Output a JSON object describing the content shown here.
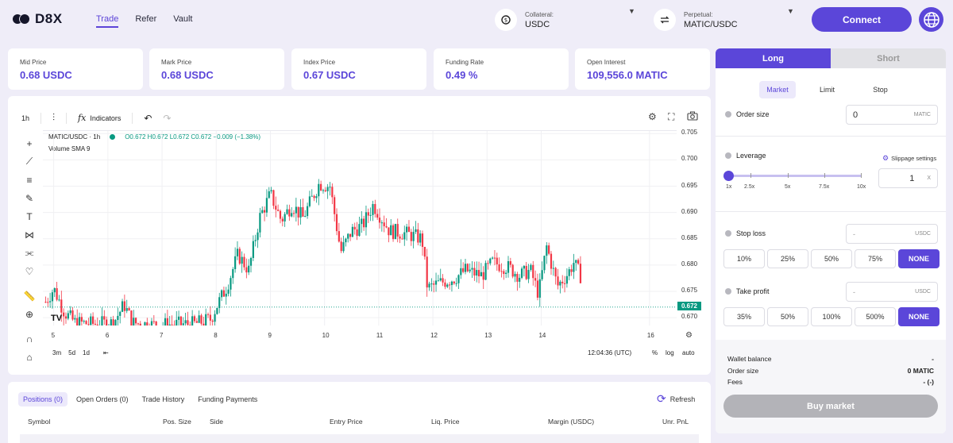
{
  "app": {
    "name": "D8X"
  },
  "nav": [
    {
      "label": "Trade",
      "active": true
    },
    {
      "label": "Refer",
      "active": false
    },
    {
      "label": "Vault",
      "active": false
    }
  ],
  "collateral": {
    "label": "Collateral:",
    "value": "USDC",
    "icon": "coins-icon"
  },
  "perpetual": {
    "label": "Perpetual:",
    "value": "MATIC/USDC",
    "icon": "swap-icon"
  },
  "connect_label": "Connect",
  "stats": [
    {
      "label": "Mid Price",
      "value": "0.68 USDC"
    },
    {
      "label": "Mark Price",
      "value": "0.68 USDC"
    },
    {
      "label": "Index Price",
      "value": "0.67 USDC"
    },
    {
      "label": "Funding Rate",
      "value": "0.49 %"
    },
    {
      "label": "Open Interest",
      "value": "109,556.0 MATIC"
    }
  ],
  "chart": {
    "interval": "1h",
    "indicators_label": "Indicators",
    "symbol": "MATIC/USDC · 1h",
    "ohlc": "O0.672 H0.672 L0.672 C0.672 −0.009 (−1.38%)",
    "volume_label": "Volume SMA 9",
    "price_tag": "0.672",
    "ranges": [
      "3m",
      "5d",
      "1d"
    ],
    "time": "12:04:36 (UTC)",
    "pct": "%",
    "log": "log",
    "auto": "auto"
  },
  "chart_data": {
    "type": "candlestick",
    "symbol": "MATIC/USDC",
    "interval": "1h",
    "y_ticks": [
      "0.705",
      "0.700",
      "0.695",
      "0.690",
      "0.685",
      "0.680",
      "0.675",
      "0.670"
    ],
    "x_ticks": [
      "5",
      "6",
      "7",
      "8",
      "9",
      "10",
      "11",
      "12",
      "13",
      "14",
      "16"
    ],
    "ylim": [
      0.6685,
      0.7055
    ],
    "xlim": [
      4.8,
      16.5
    ],
    "last_price": 0.672,
    "close_path": [
      [
        4.85,
        0.673
      ],
      [
        5.0,
        0.6755
      ],
      [
        5.2,
        0.671
      ],
      [
        5.4,
        0.669
      ],
      [
        5.8,
        0.6688
      ],
      [
        6.1,
        0.669
      ],
      [
        6.3,
        0.6725
      ],
      [
        6.45,
        0.669
      ],
      [
        6.8,
        0.6686
      ],
      [
        7.2,
        0.6687
      ],
      [
        7.6,
        0.6688
      ],
      [
        7.9,
        0.6697
      ],
      [
        8.0,
        0.672
      ],
      [
        8.2,
        0.676
      ],
      [
        8.4,
        0.682
      ],
      [
        8.6,
        0.679
      ],
      [
        8.8,
        0.689
      ],
      [
        9.0,
        0.6935
      ],
      [
        9.2,
        0.6885
      ],
      [
        9.4,
        0.6915
      ],
      [
        9.6,
        0.689
      ],
      [
        9.9,
        0.6955
      ],
      [
        10.1,
        0.695
      ],
      [
        10.3,
        0.6825
      ],
      [
        10.5,
        0.6865
      ],
      [
        10.7,
        0.6875
      ],
      [
        10.9,
        0.6915
      ],
      [
        11.2,
        0.6865
      ],
      [
        11.5,
        0.686
      ],
      [
        11.8,
        0.685
      ],
      [
        11.9,
        0.6755
      ],
      [
        12.1,
        0.6765
      ],
      [
        12.4,
        0.6775
      ],
      [
        12.6,
        0.679
      ],
      [
        12.9,
        0.678
      ],
      [
        13.1,
        0.6805
      ],
      [
        13.4,
        0.6795
      ],
      [
        13.6,
        0.678
      ],
      [
        13.8,
        0.679
      ],
      [
        13.95,
        0.6745
      ],
      [
        14.1,
        0.6835
      ],
      [
        14.3,
        0.676
      ],
      [
        14.5,
        0.6785
      ],
      [
        14.6,
        0.6805
      ],
      [
        14.75,
        0.6775
      ]
    ]
  },
  "order": {
    "tabs": [
      "Long",
      "Short"
    ],
    "types": [
      "Market",
      "Limit",
      "Stop"
    ],
    "order_size_label": "Order size",
    "order_size_value": "0",
    "order_size_unit": "MATIC",
    "leverage_label": "Leverage",
    "slippage_label": "Slippage settings",
    "leverage_marks": [
      "1x",
      "2.5x",
      "5x",
      "7.5x",
      "10x"
    ],
    "leverage_value": "1",
    "leverage_unit": "X",
    "leverage_level": 1,
    "stop_loss_label": "Stop loss",
    "stop_loss_placeholder": "-",
    "stop_loss_unit": "USDC",
    "stop_loss_options": [
      "10%",
      "25%",
      "50%",
      "75%",
      "NONE"
    ],
    "take_profit_label": "Take profit",
    "take_profit_placeholder": "-",
    "take_profit_unit": "USDC",
    "take_profit_options": [
      "35%",
      "50%",
      "100%",
      "500%",
      "NONE"
    ],
    "summary": [
      {
        "label": "Wallet balance",
        "value": "-"
      },
      {
        "label": "Order size",
        "value": "0 MATIC"
      },
      {
        "label": "Fees",
        "value": "- (-)"
      }
    ],
    "buy_label": "Buy market"
  },
  "positions": {
    "tabs": [
      "Positions (0)",
      "Open Orders (0)",
      "Trade History",
      "Funding Payments"
    ],
    "refresh_label": "Refresh",
    "columns": [
      "Symbol",
      "Pos. Size",
      "Side",
      "Entry Price",
      "Liq. Price",
      "Margin (USDC)",
      "Unr. PnL"
    ]
  },
  "colors": {
    "accent": "#5b46d9",
    "up": "#089981",
    "down": "#f23645"
  }
}
